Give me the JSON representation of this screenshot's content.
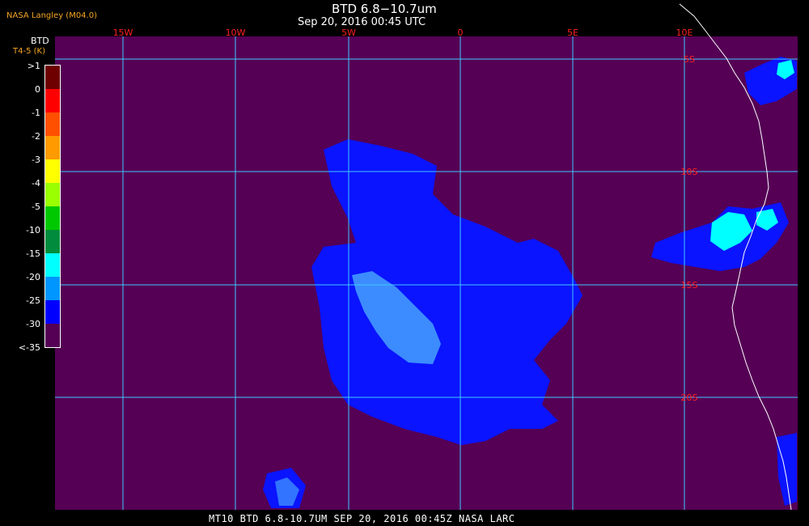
{
  "header": {
    "agency": "NASA Langley (M04.0)",
    "title": "BTD 6.8−10.7um",
    "subtitle": "Sep 20, 2016 00:45 UTC"
  },
  "footer": {
    "caption": "MT10  BTD 6.8-10.7UM  SEP 20, 2016 00:45Z  NASA LARC"
  },
  "colorbar": {
    "title": "BTD",
    "subtitle": "T4-5 (K)",
    "labels": [
      ">1",
      "0",
      "-1",
      "-2",
      "-3",
      "-4",
      "-5",
      "-10",
      "-15",
      "-20",
      "-25",
      "-30",
      "<-35"
    ],
    "colors": [
      "#6e0000",
      "#ff0000",
      "#ff5000",
      "#ff9a00",
      "#ffff00",
      "#9aff00",
      "#00c800",
      "#008c3c",
      "#00ffff",
      "#0096ff",
      "#0000ff",
      "#550055"
    ]
  },
  "map": {
    "background_color": "#550055",
    "grid_color": "#40c8ff",
    "label_color": "#ff2020",
    "coast_color": "#ffffff",
    "lon_labels": [
      "15W",
      "10W",
      "5W",
      "0",
      "5E",
      "10E"
    ],
    "lat_labels": [
      "5S",
      "10S",
      "15S",
      "20S"
    ]
  }
}
